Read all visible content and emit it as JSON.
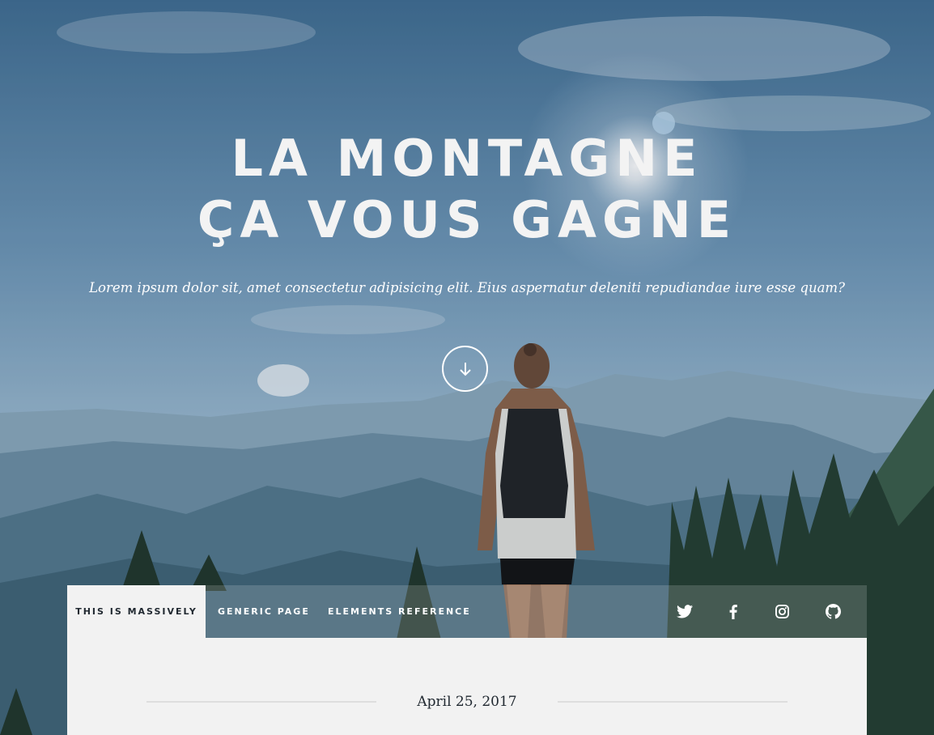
{
  "hero": {
    "title_line1": "LA MONTAGNE",
    "title_line2": "ÇA VOUS GAGNE",
    "subtitle": "Lorem ipsum dolor sit, amet consectetur adipisicing elit. Eius aspernatur deleniti repudiandae iure esse quam?",
    "scroll_icon": "arrow-down-icon"
  },
  "nav": {
    "items": [
      {
        "label": "THIS IS MASSIVELY",
        "active": true
      },
      {
        "label": "GENERIC PAGE",
        "active": false
      },
      {
        "label": "ELEMENTS REFERENCE",
        "active": false
      }
    ],
    "social": [
      "twitter-icon",
      "facebook-icon",
      "instagram-icon",
      "github-icon"
    ]
  },
  "post": {
    "date": "April 25, 2017"
  },
  "colors": {
    "nav_active_bg": "#f2f2f2",
    "nav_active_text": "#212931",
    "main_bg": "#f2f2f2",
    "hero_text": "#f3f3f3"
  }
}
